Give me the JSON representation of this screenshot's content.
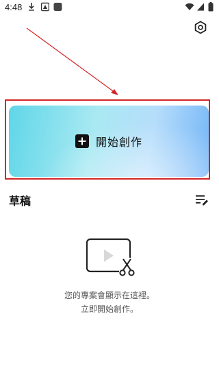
{
  "status_bar": {
    "time": "4:48"
  },
  "header": {
    "settings_icon": "hexagon-settings-icon"
  },
  "create_card": {
    "label": "開始創作",
    "icon": "plus-square-icon",
    "gradient_colors": [
      "#5fd6e8",
      "#a9e9f2",
      "#b6ddfb",
      "#74b6f7"
    ]
  },
  "annotation": {
    "highlight_color": "#d32525"
  },
  "drafts": {
    "title": "草稿",
    "menu_icon": "list-edit-icon"
  },
  "empty_state": {
    "icon": "video-scissors-icon",
    "line1": "您的專案會顯示在這裡。",
    "line2": "立即開始創作。"
  }
}
